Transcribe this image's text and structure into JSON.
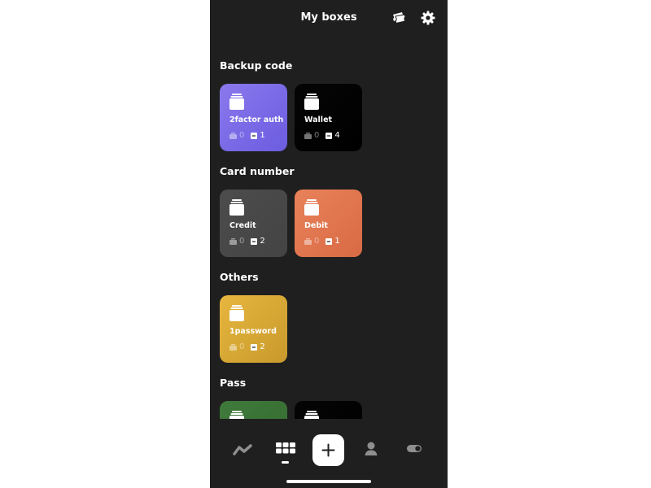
{
  "header": {
    "title": "My boxes",
    "icons": [
      "tickets-icon",
      "gear-icon"
    ]
  },
  "sections": [
    {
      "title": "Backup code",
      "cards": [
        {
          "name": "2factor auth",
          "count_a": "0",
          "count_b": "1",
          "color_from": "#8a79ec",
          "color_to": "#6c5ce0"
        },
        {
          "name": "Wallet",
          "count_a": "0",
          "count_b": "4",
          "color_from": "#050505",
          "color_to": "#000000"
        }
      ]
    },
    {
      "title": "Card number",
      "cards": [
        {
          "name": "Credit",
          "count_a": "0",
          "count_b": "2",
          "color_from": "#4c4c4c",
          "color_to": "#444444"
        },
        {
          "name": "Debit",
          "count_a": "0",
          "count_b": "1",
          "color_from": "#e8825a",
          "color_to": "#d96a44"
        }
      ]
    },
    {
      "title": "Others",
      "cards": [
        {
          "name": "1password",
          "count_a": "0",
          "count_b": "2",
          "color_from": "#e6b63e",
          "color_to": "#c99a2c"
        }
      ]
    },
    {
      "title": "Pass",
      "cards": [
        {
          "name": "",
          "count_a": "",
          "count_b": "",
          "color_from": "#3f7a3b",
          "color_to": "#356a31"
        },
        {
          "name": "",
          "count_a": "",
          "count_b": "",
          "color_from": "#050505",
          "color_to": "#000000"
        }
      ]
    }
  ],
  "tabbar": {
    "tabs": [
      "activity-icon",
      "boxes-grid-icon",
      "add-icon",
      "profile-icon",
      "toggle-icon"
    ],
    "active": "boxes-grid-icon"
  }
}
